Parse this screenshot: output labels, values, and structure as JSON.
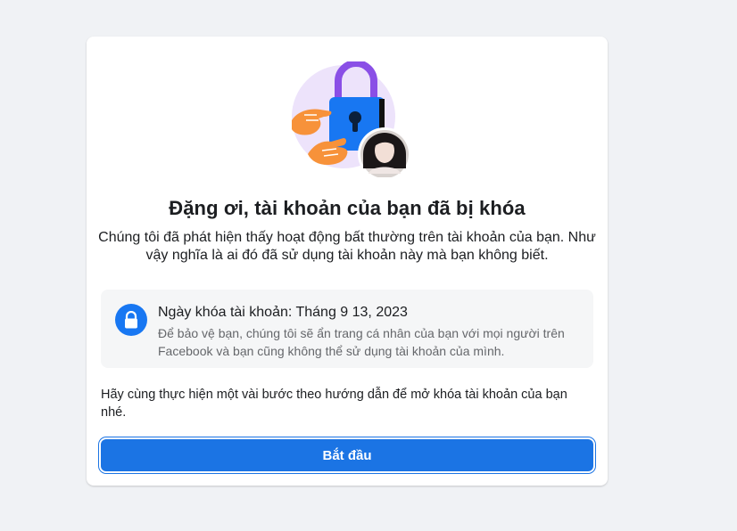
{
  "card": {
    "title": "Đặng ơi, tài khoản của bạn đã bị khóa",
    "description": "Chúng tôi đã phát hiện thấy hoạt động bất thường trên tài khoản của bạn. Như vậy nghĩa là ai đó đã sử dụng tài khoản này mà bạn không biết.",
    "info": {
      "icon": "lock-icon",
      "title": "Ngày khóa tài khoản: Tháng 9 13, 2023",
      "description": "Để bảo vệ bạn, chúng tôi sẽ ẩn trang cá nhân của bạn với mọi người trên Facebook và bạn cũng không thể sử dụng tài khoản của mình."
    },
    "steps_text": "Hãy cùng thực hiện một vài bước theo hướng dẫn để mở khóa tài khoản của bạn nhé.",
    "start_button_label": "Bắt đầu"
  },
  "colors": {
    "page_background": "#f0f2f5",
    "card_background": "#ffffff",
    "primary_blue": "#1b74e4",
    "info_box_background": "#f5f6f7",
    "illustration_circle": "#ede3fb",
    "padlock_body": "#1877f2",
    "padlock_shackle": "#8a4fe6",
    "hand": "#f7923a"
  },
  "illustration": {
    "icons": [
      "padlock-icon",
      "hand-icon",
      "profile-avatar"
    ]
  }
}
